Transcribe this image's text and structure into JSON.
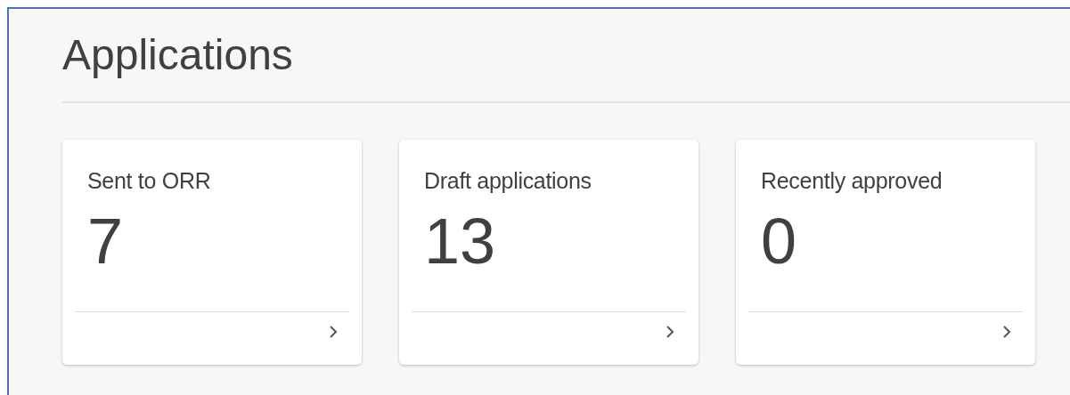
{
  "title": "Applications",
  "cards": [
    {
      "label": "Sent to ORR",
      "count": "7"
    },
    {
      "label": "Draft applications",
      "count": "13"
    },
    {
      "label": "Recently approved",
      "count": "0"
    }
  ]
}
